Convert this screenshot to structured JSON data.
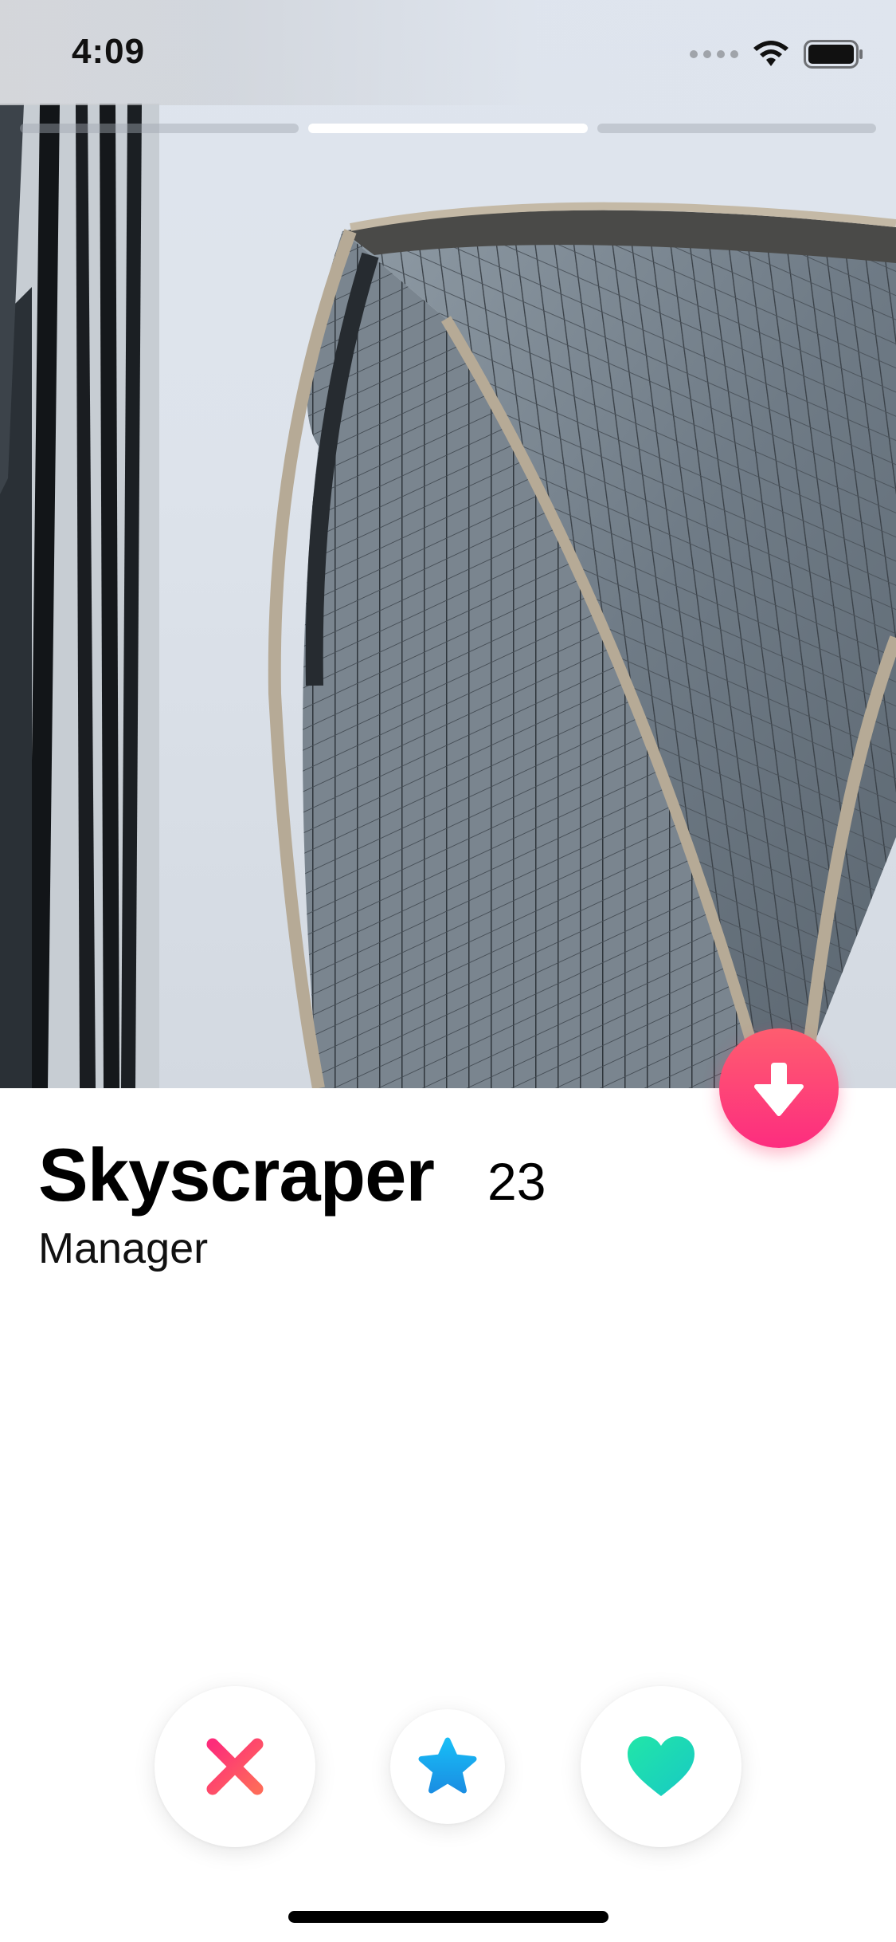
{
  "status_bar": {
    "time": "4:09"
  },
  "photo": {
    "count": 3,
    "active_index": 1,
    "subject": "building-photo"
  },
  "profile": {
    "name": "Skyscraper",
    "age": "23",
    "job": "Manager"
  },
  "actions": {
    "info_icon": "arrow-down-icon",
    "dislike_icon": "close-icon",
    "superlike_icon": "star-icon",
    "like_icon": "heart-icon"
  },
  "colors": {
    "info_gradient_top": "#fe5d6f",
    "info_gradient_bottom": "#fd2d7f",
    "dislike": "#fd4a6b",
    "superlike": "#1aa8ee",
    "like": "#1fdfb0"
  }
}
